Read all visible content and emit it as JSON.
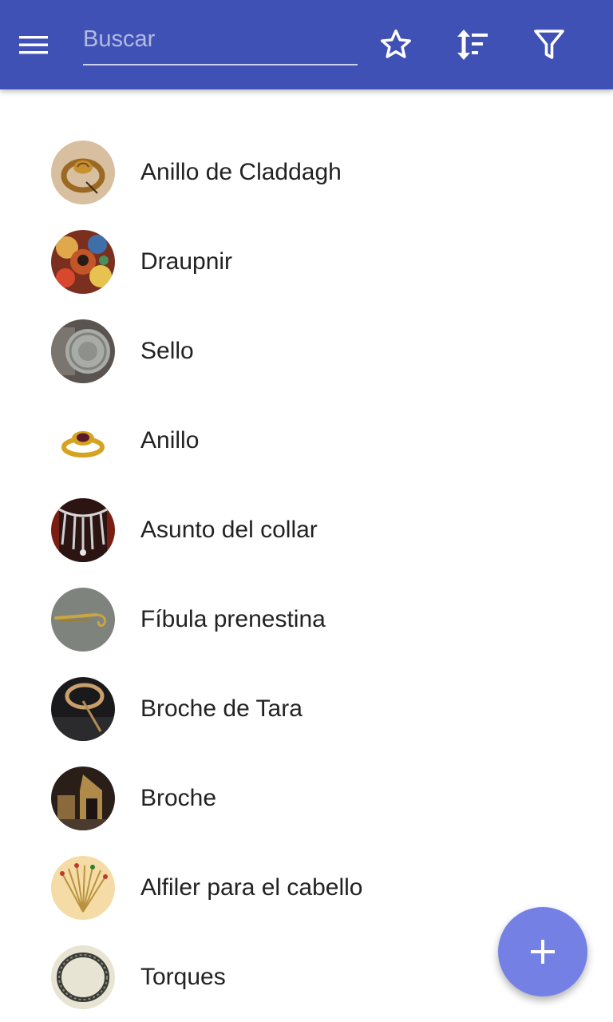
{
  "app_bar": {
    "background": "#3f51b5",
    "menu_icon": "menu-icon",
    "search": {
      "placeholder": "Buscar",
      "value": ""
    },
    "actions": [
      "star-outline-icon",
      "sort-icon",
      "filter-icon"
    ]
  },
  "items": [
    {
      "label": "Anillo de Claddagh",
      "icon": "claddagh-ring-thumbnail"
    },
    {
      "label": "Draupnir",
      "icon": "draupnir-thumbnail"
    },
    {
      "label": "Sello",
      "icon": "seal-thumbnail"
    },
    {
      "label": "Anillo",
      "icon": "ring-thumbnail"
    },
    {
      "label": "Asunto del collar",
      "icon": "necklace-thumbnail"
    },
    {
      "label": "Fíbula prenestina",
      "icon": "fibula-thumbnail"
    },
    {
      "label": "Broche de Tara",
      "icon": "tara-brooch-thumbnail"
    },
    {
      "label": "Broche",
      "icon": "brooch-thumbnail"
    },
    {
      "label": "Alfiler para el cabello",
      "icon": "hairpin-thumbnail"
    },
    {
      "label": "Torques",
      "icon": "torc-thumbnail"
    }
  ],
  "fab": {
    "icon": "plus-icon",
    "color": "#7480e4"
  }
}
